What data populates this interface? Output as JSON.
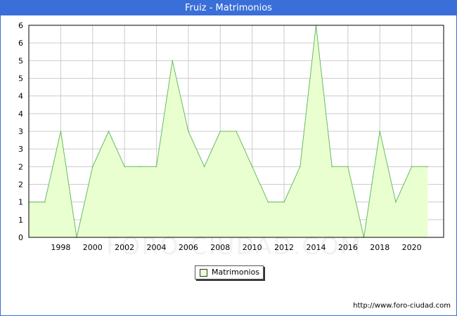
{
  "header": {
    "title": "Fruiz - Matrimonios"
  },
  "watermark": "FORO-CIUDAD.COM",
  "footer": {
    "source_url": "http://www.foro-ciudad.com"
  },
  "colors": {
    "title_bar": "#3a6ed8",
    "series_fill": "#eaffcf",
    "series_line": "#66bb66",
    "grid": "#cccccc"
  },
  "chart_data": {
    "type": "area",
    "title": "Fruiz - Matrimonios",
    "xlabel": "",
    "ylabel": "",
    "x": [
      1996,
      1997,
      1998,
      1999,
      2000,
      2001,
      2002,
      2003,
      2004,
      2005,
      2006,
      2007,
      2008,
      2009,
      2010,
      2011,
      2012,
      2013,
      2014,
      2015,
      2016,
      2017,
      2018,
      2019,
      2020,
      2021
    ],
    "series": [
      {
        "name": "Matrimonios",
        "values": [
          1,
          1,
          3,
          0,
          2,
          3,
          2,
          2,
          2,
          5,
          3,
          2,
          3,
          3,
          2,
          1,
          1,
          2,
          6,
          2,
          2,
          0,
          3,
          1,
          2,
          2
        ]
      }
    ],
    "x_ticks": [
      "1998",
      "2000",
      "2002",
      "2004",
      "2006",
      "2008",
      "2010",
      "2012",
      "2014",
      "2016",
      "2018",
      "2020"
    ],
    "y_ticks": [
      "0",
      "1",
      "1",
      "2",
      "2",
      "3",
      "3",
      "4",
      "4",
      "5",
      "5",
      "6",
      "6"
    ],
    "xlim": [
      1996,
      2022
    ],
    "ylim": [
      0,
      6
    ],
    "grid": true,
    "legend_position": "bottom-center"
  }
}
